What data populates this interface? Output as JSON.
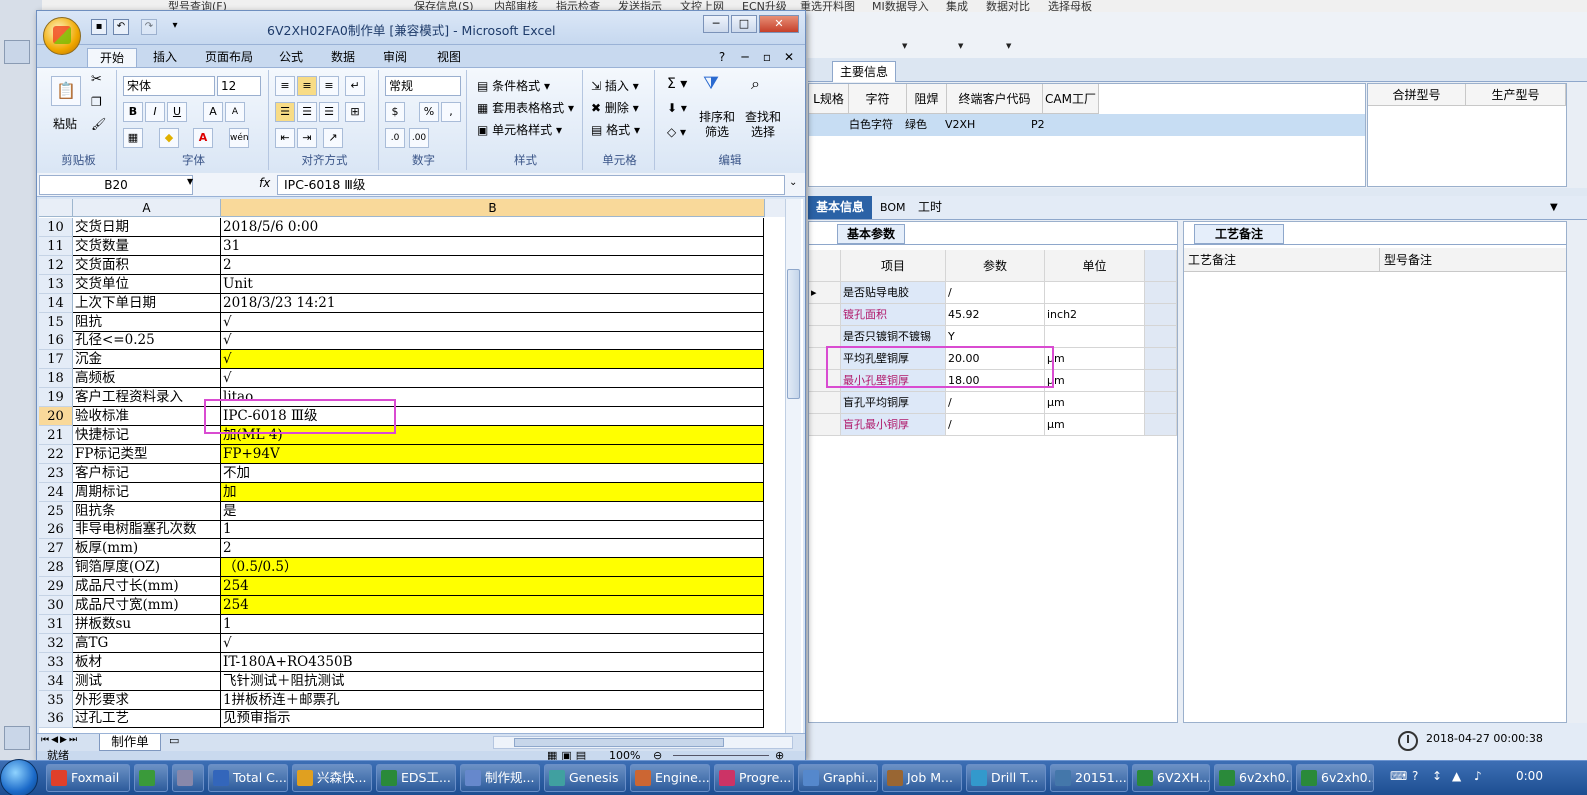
{
  "background_app": {
    "menu": [
      "型号查询(F)",
      "保存信息(S)",
      "内部审核",
      "指示检查",
      "发送指示",
      "文控上网",
      "ECN升级",
      "重选开料图",
      "MI数据导入",
      "集成",
      "数据对比",
      "选择母板"
    ],
    "main_tab": "主要信息",
    "grid1_headers": [
      "L规格",
      "字符",
      "阻焊",
      "终端客户代码",
      "CAM工厂"
    ],
    "grid1_row": [
      "白色字符",
      "绿色",
      "V2XH",
      "P2"
    ],
    "grid2_headers": [
      "合拼型号",
      "生产型号"
    ],
    "sub_tabs": [
      "基本信息",
      "BOM",
      "工时"
    ],
    "params_tab": "基本参数",
    "params_headers": [
      "项目",
      "参数",
      "单位"
    ],
    "params_rows": [
      {
        "item": "是否贴导电胶",
        "value": "/",
        "unit": "",
        "pink": false
      },
      {
        "item": "镀孔面积",
        "value": "45.92",
        "unit": "inch2",
        "pink": true
      },
      {
        "item": "是否只镀铜不镀锡",
        "value": "Y",
        "unit": "",
        "pink": false
      },
      {
        "item": "平均孔壁铜厚",
        "value": "20.00",
        "unit": "μm",
        "pink": false
      },
      {
        "item": "最小孔壁铜厚",
        "value": "18.00",
        "unit": "μm",
        "pink": true
      },
      {
        "item": "盲孔平均铜厚",
        "value": "/",
        "unit": "μm",
        "pink": false
      },
      {
        "item": "盲孔最小铜厚",
        "value": "/",
        "unit": "μm",
        "pink": true
      }
    ],
    "notes_tab": "工艺备注",
    "notes_headers": [
      "工艺备注",
      "型号备注"
    ],
    "datetime": "2018-04-27 00:00:38"
  },
  "excel": {
    "title": "6V2XH02FA0制作单  [兼容模式] - Microsoft Excel",
    "ribbon_tabs": [
      "开始",
      "插入",
      "页面布局",
      "公式",
      "数据",
      "审阅",
      "视图"
    ],
    "ribbon": {
      "paste": "粘贴",
      "font_name": "宋体",
      "font_size": "12",
      "number_format": "常规",
      "cond_format": "条件格式",
      "table_format": "套用表格格式",
      "cell_style": "单元格样式",
      "insert": "插入",
      "delete": "删除",
      "format": "格式",
      "sort_filter": "排序和筛选",
      "find_select": "查找和选择",
      "groups": [
        "剪贴板",
        "字体",
        "对齐方式",
        "数字",
        "样式",
        "单元格",
        "编辑"
      ]
    },
    "name_box": "B20",
    "formula_value": "IPC-6018 Ⅲ级",
    "columns": [
      "A",
      "B"
    ],
    "rows": [
      {
        "n": "10",
        "a": "交货日期",
        "b": "2018/5/6 0:00",
        "yellow": false
      },
      {
        "n": "11",
        "a": "交货数量",
        "b": "31",
        "yellow": false
      },
      {
        "n": "12",
        "a": "交货面积",
        "b": "2",
        "yellow": false
      },
      {
        "n": "13",
        "a": "交货单位",
        "b": "Unit",
        "yellow": false
      },
      {
        "n": "14",
        "a": "上次下单日期",
        "b": "2018/3/23 14:21",
        "yellow": false
      },
      {
        "n": "15",
        "a": "阻抗",
        "b": "√",
        "yellow": false
      },
      {
        "n": "16",
        "a": "孔径<=0.25",
        "b": "√",
        "yellow": false
      },
      {
        "n": "17",
        "a": "沉金",
        "b": "√",
        "yellow": true
      },
      {
        "n": "18",
        "a": "高频板",
        "b": "√",
        "yellow": false
      },
      {
        "n": "19",
        "a": "客户工程资料录入",
        "b": "litao",
        "yellow": false
      },
      {
        "n": "20",
        "a": "验收标准",
        "b": "IPC-6018 Ⅲ级",
        "yellow": false
      },
      {
        "n": "21",
        "a": "快捷标记",
        "b": "加(ML 4)",
        "yellow": true
      },
      {
        "n": "22",
        "a": "FP标记类型",
        "b": "FP+94V",
        "yellow": true
      },
      {
        "n": "23",
        "a": "客户标记",
        "b": "不加",
        "yellow": false
      },
      {
        "n": "24",
        "a": "周期标记",
        "b": "加",
        "yellow": true
      },
      {
        "n": "25",
        "a": "阻抗条",
        "b": "是",
        "yellow": false
      },
      {
        "n": "26",
        "a": "非导电树脂塞孔次数",
        "b": "1",
        "yellow": false
      },
      {
        "n": "27",
        "a": "板厚(mm)",
        "b": "2",
        "yellow": false
      },
      {
        "n": "28",
        "a": "铜箔厚度(OZ)",
        "b": "（0.5/0.5）",
        "yellow": true
      },
      {
        "n": "29",
        "a": "成品尺寸长(mm)",
        "b": "254",
        "yellow": true
      },
      {
        "n": "30",
        "a": "成品尺寸宽(mm)",
        "b": "254",
        "yellow": true
      },
      {
        "n": "31",
        "a": "拼板数su",
        "b": "1",
        "yellow": false
      },
      {
        "n": "32",
        "a": "高TG",
        "b": "√",
        "yellow": false
      },
      {
        "n": "33",
        "a": "板材",
        "b": "IT-180A+RO4350B",
        "yellow": false
      },
      {
        "n": "34",
        "a": "测试",
        "b": "飞针测试＋阻抗测试",
        "yellow": false
      },
      {
        "n": "35",
        "a": "外形要求",
        "b": "1拼板桥连＋邮票孔",
        "yellow": false
      },
      {
        "n": "36",
        "a": "过孔工艺",
        "b": "见预审指示",
        "yellow": false
      }
    ],
    "sheet_tab": "制作单",
    "status_ready": "就绪",
    "zoom": "100%"
  },
  "taskbar": {
    "items": [
      "Foxmail",
      "",
      "",
      "Total C...",
      "兴森快...",
      "EDS工...",
      "制作规...",
      "Genesis",
      "Engine...",
      "Progre...",
      "Graphi...",
      "Job M...",
      "Drill T...",
      "20151...",
      "6V2XH...",
      "6v2xh0...",
      "6v2xh0..."
    ],
    "clock": "0:00"
  },
  "colors": {
    "yellow": "#ffff00",
    "highlight": "#d94bd1",
    "selected_row": "#c7ddf3"
  }
}
